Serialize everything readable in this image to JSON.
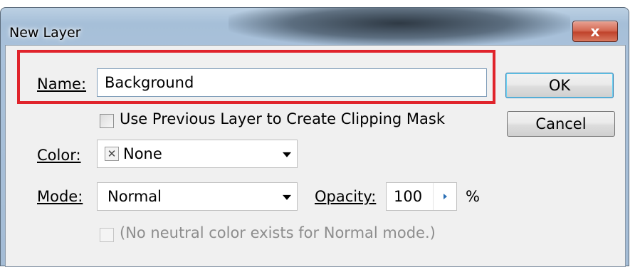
{
  "window": {
    "title": "New Layer",
    "close_glyph": "x"
  },
  "name": {
    "label": "Name:",
    "value": "Background"
  },
  "clipping": {
    "label": "Use Previous Layer to Create Clipping Mask",
    "checked": false
  },
  "color": {
    "label": "Color:",
    "value": "None",
    "swatch_glyph": "✕"
  },
  "mode": {
    "label": "Mode:",
    "value": "Normal"
  },
  "opacity": {
    "label": "Opacity:",
    "value": "100",
    "unit": "%"
  },
  "neutral": {
    "label": "(No neutral color exists for Normal mode.)",
    "checked": false,
    "enabled": false
  },
  "buttons": {
    "ok": "OK",
    "cancel": "Cancel"
  },
  "colors": {
    "highlight": "#e0242c",
    "dialog_bg": "#f0f0f0",
    "accent_arrow": "#2b6fb5"
  }
}
